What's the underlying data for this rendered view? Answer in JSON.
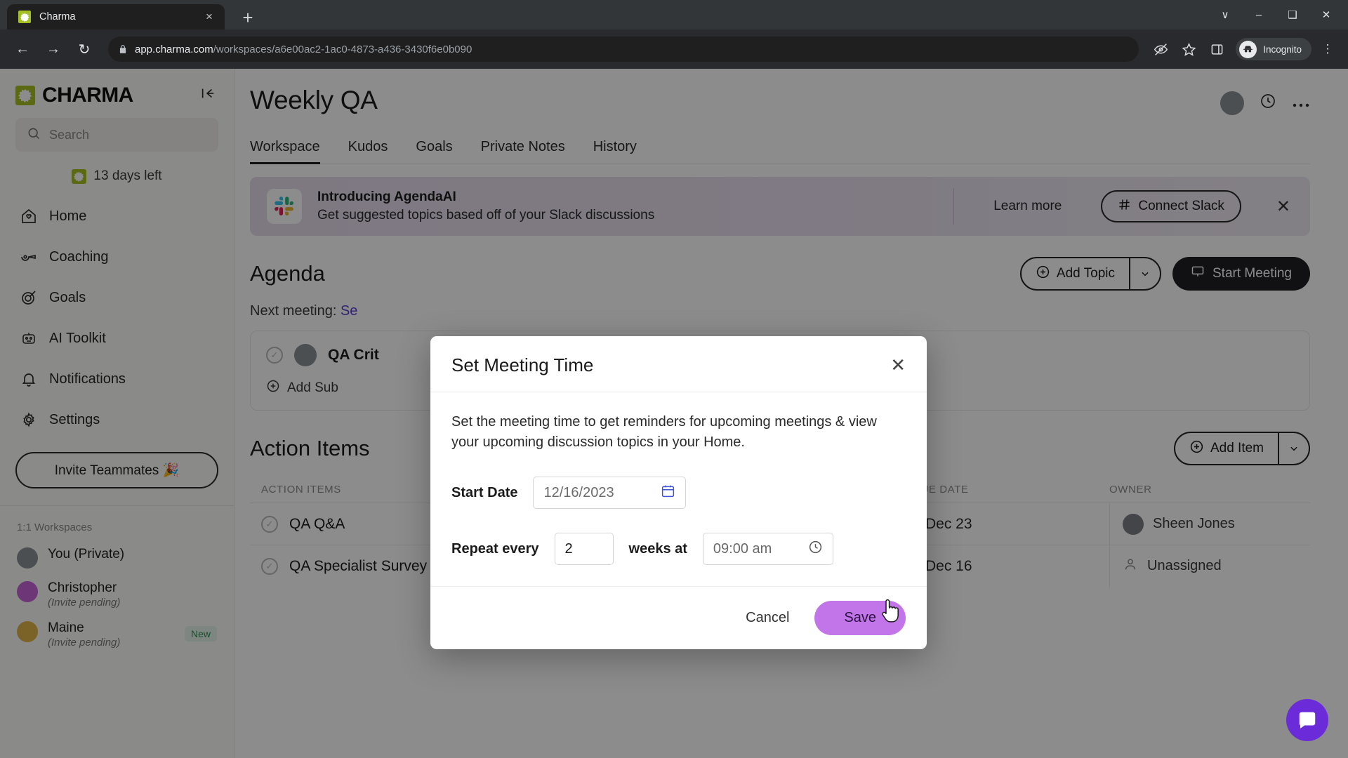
{
  "browser": {
    "tab": {
      "title": "Charma",
      "favicon": "charma-logo-icon",
      "close": "×"
    },
    "new_tab": "+",
    "window_controls": {
      "minimize": "–",
      "maximize": "❑",
      "close": "✕",
      "more_tabs": "∨"
    },
    "nav": {
      "back": "←",
      "forward": "→",
      "reload": "↻"
    },
    "omnibox": {
      "lock": "lock-icon",
      "domain": "app.charma.com",
      "path": "/workspaces/a6e00ac2-1ac0-4873-a436-3430f6e0b090",
      "full_url": "app.charma.com/workspaces/a6e00ac2-1ac0-4873-a436-3430f6e0b090"
    },
    "toolbar_icons": [
      "eye-slash-icon",
      "star-icon",
      "side-panel-icon"
    ],
    "profile": {
      "label": "Incognito",
      "icon": "incognito-hat-icon"
    },
    "menu": "⋮"
  },
  "sidebar": {
    "brand": "CHARMA",
    "collapse_icon": "collapse-panel-icon",
    "search": {
      "placeholder": "Search",
      "value": "",
      "icon": "search-icon"
    },
    "trial": "13 days left",
    "nav_items": [
      {
        "label": "Home",
        "icon": "home-icon"
      },
      {
        "label": "Coaching",
        "icon": "whistle-icon"
      },
      {
        "label": "Goals",
        "icon": "target-icon"
      },
      {
        "label": "AI Toolkit",
        "icon": "robot-icon"
      },
      {
        "label": "Notifications",
        "icon": "bell-icon"
      },
      {
        "label": "Settings",
        "icon": "gear-icon"
      }
    ],
    "invite_button": "Invite Teammates 🎉",
    "workspaces_title": "1:1 Workspaces",
    "workspaces": [
      {
        "name": "You (Private)",
        "sub": "",
        "badge": "",
        "avatar_color": "#8a9096"
      },
      {
        "name": "Christopher",
        "sub": "(Invite pending)",
        "badge": "",
        "avatar_color": "#c765d9"
      },
      {
        "name": "Maine",
        "sub": "(Invite pending)",
        "badge": "New",
        "avatar_color": "#e0b44a"
      }
    ]
  },
  "main": {
    "page_title": "Weekly QA",
    "header_icons": [
      "avatar",
      "clock-icon",
      "more-horizontal-icon"
    ],
    "tabs": [
      {
        "label": "Workspace",
        "active": true
      },
      {
        "label": "Kudos",
        "active": false
      },
      {
        "label": "Goals",
        "active": false
      },
      {
        "label": "Private Notes",
        "active": false
      },
      {
        "label": "History",
        "active": false
      }
    ],
    "banner": {
      "icon": "slack-icon",
      "title": "Introducing AgendaAI",
      "subtitle": "Get suggested topics based off of your Slack discussions",
      "learn_more": "Learn more",
      "connect_button": "Connect Slack",
      "close": "✕"
    },
    "agenda": {
      "title": "Agenda",
      "add_topic": "Add Topic",
      "start_meeting": "Start Meeting",
      "next_meeting_label": "Next meeting:",
      "next_meeting_link": "Se",
      "topic": "QA Crit",
      "add_subtopic": "Add Sub"
    },
    "action_items": {
      "title": "Action Items",
      "add_item": "Add Item",
      "columns": [
        "ACTION ITEMS",
        "DUE DATE",
        "OWNER"
      ],
      "rows": [
        {
          "name": "QA Q&A",
          "date": "Dec 23",
          "owner": "Sheen Jones",
          "owner_assigned": true
        },
        {
          "name": "QA Specialist Survey",
          "date": "Dec 16",
          "owner": "Unassigned",
          "owner_assigned": false
        }
      ]
    },
    "intercom": "messenger-icon"
  },
  "modal": {
    "title": "Set Meeting Time",
    "close": "✕",
    "description": "Set the meeting time to get reminders for upcoming meetings & view your upcoming discussion topics in your Home.",
    "start_date_label": "Start Date",
    "start_date_value": "12/16/2023",
    "calendar_icon": "calendar-icon",
    "repeat_label": "Repeat every",
    "repeat_value": "2",
    "repeat_unit": "weeks at",
    "time_value": "09:00 am",
    "clock_icon": "clock-icon",
    "cancel": "Cancel",
    "save": "Save"
  },
  "colors": {
    "accent_purple": "#c275e8",
    "brand_green": "#a5c022",
    "dark": "#1f2024"
  }
}
